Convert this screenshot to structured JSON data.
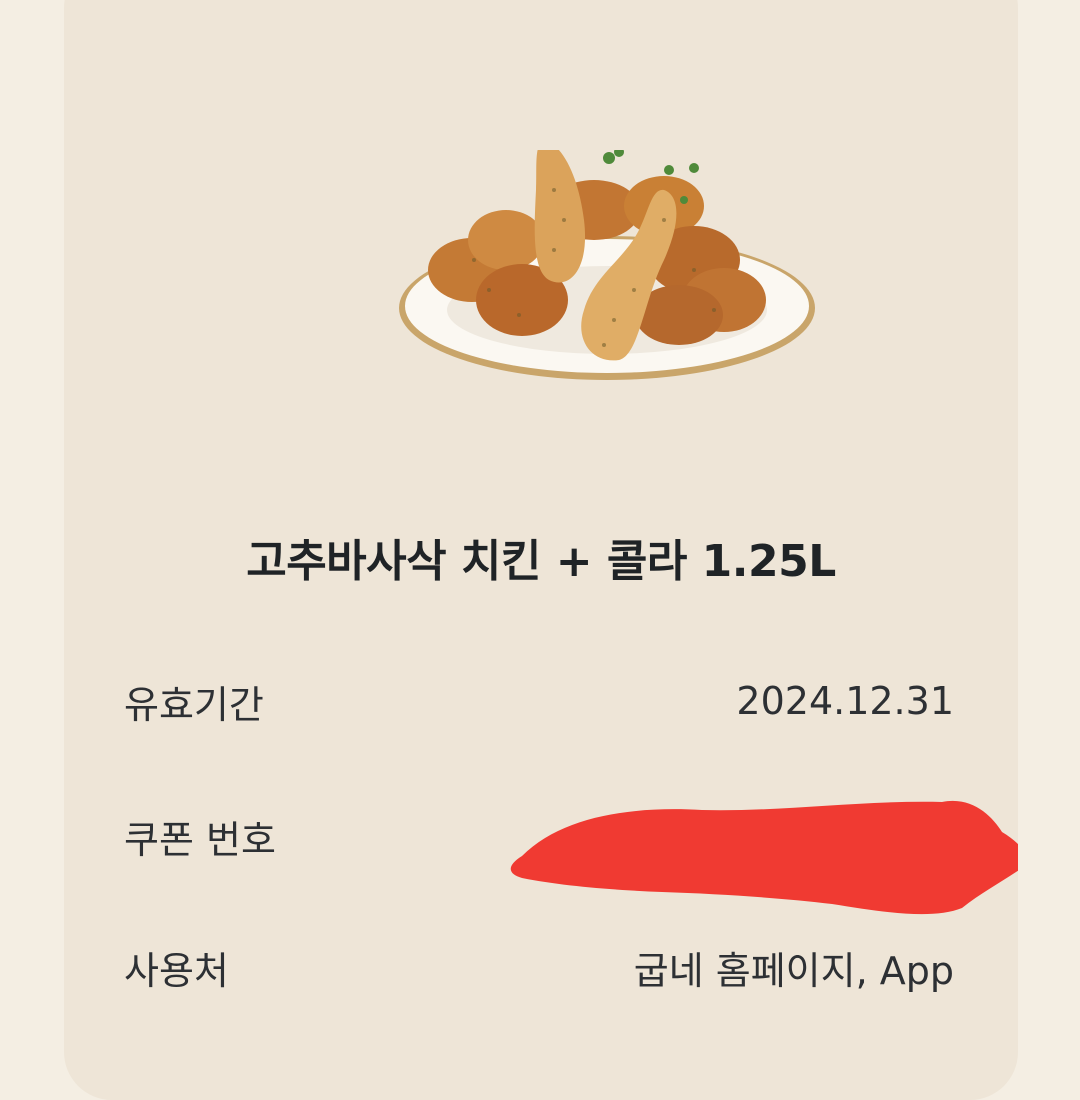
{
  "product": {
    "image": "fried-chicken-plate-image",
    "title": "고추바사삭 치킨 + 콜라 1.25L"
  },
  "details": [
    {
      "label": "유효기간",
      "value": "2024.12.31"
    },
    {
      "label": "쿠폰 번호",
      "value": ""
    },
    {
      "label": "사용처",
      "value": "굽네 홈페이지, App"
    }
  ],
  "colors": {
    "background": "#f4eee3",
    "card": "#eee5d7",
    "text": "#1f2326",
    "redaction": "#f03a32"
  }
}
